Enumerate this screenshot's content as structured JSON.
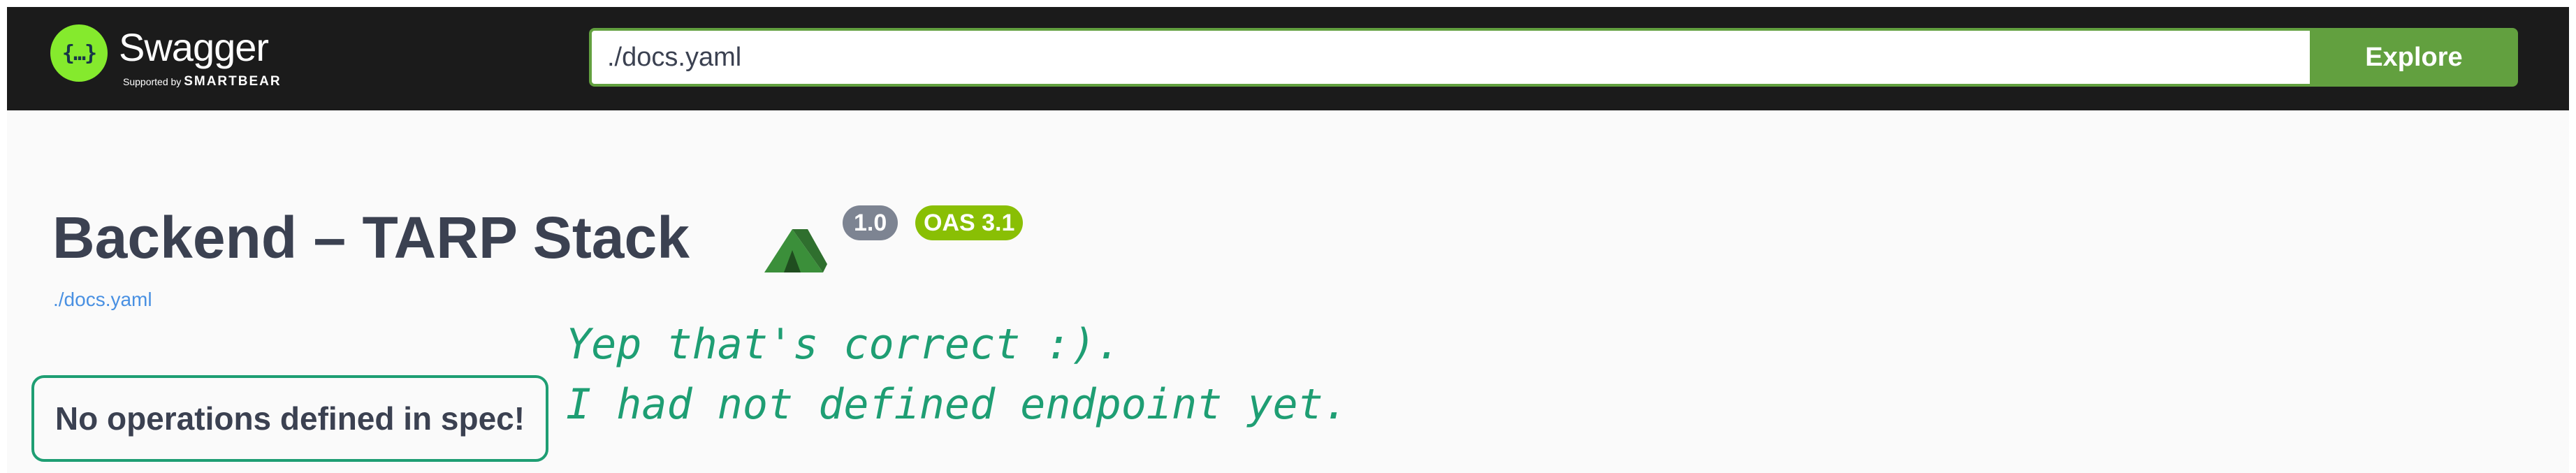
{
  "topbar": {
    "logo_name": "Swagger",
    "logo_supported_by": "Supported by",
    "logo_brand": "SMARTBEAR",
    "search": {
      "value": "./docs.yaml",
      "placeholder": ""
    },
    "explore_label": "Explore",
    "colors": {
      "bar": "#1b1b1b",
      "accent": "#62a03f",
      "logo": "#85ea2d"
    }
  },
  "info": {
    "title": "Backend – TARP Stack",
    "title_icon": "tent-icon",
    "version": "1.0",
    "oas_version": "OAS 3.1",
    "spec_url": "./docs.yaml"
  },
  "operations": {
    "empty_message": "No operations defined in spec!"
  },
  "annotation": {
    "line1": "Yep that's correct :).",
    "line2": "I had not defined endpoint yet.",
    "color": "#1e9e73"
  }
}
